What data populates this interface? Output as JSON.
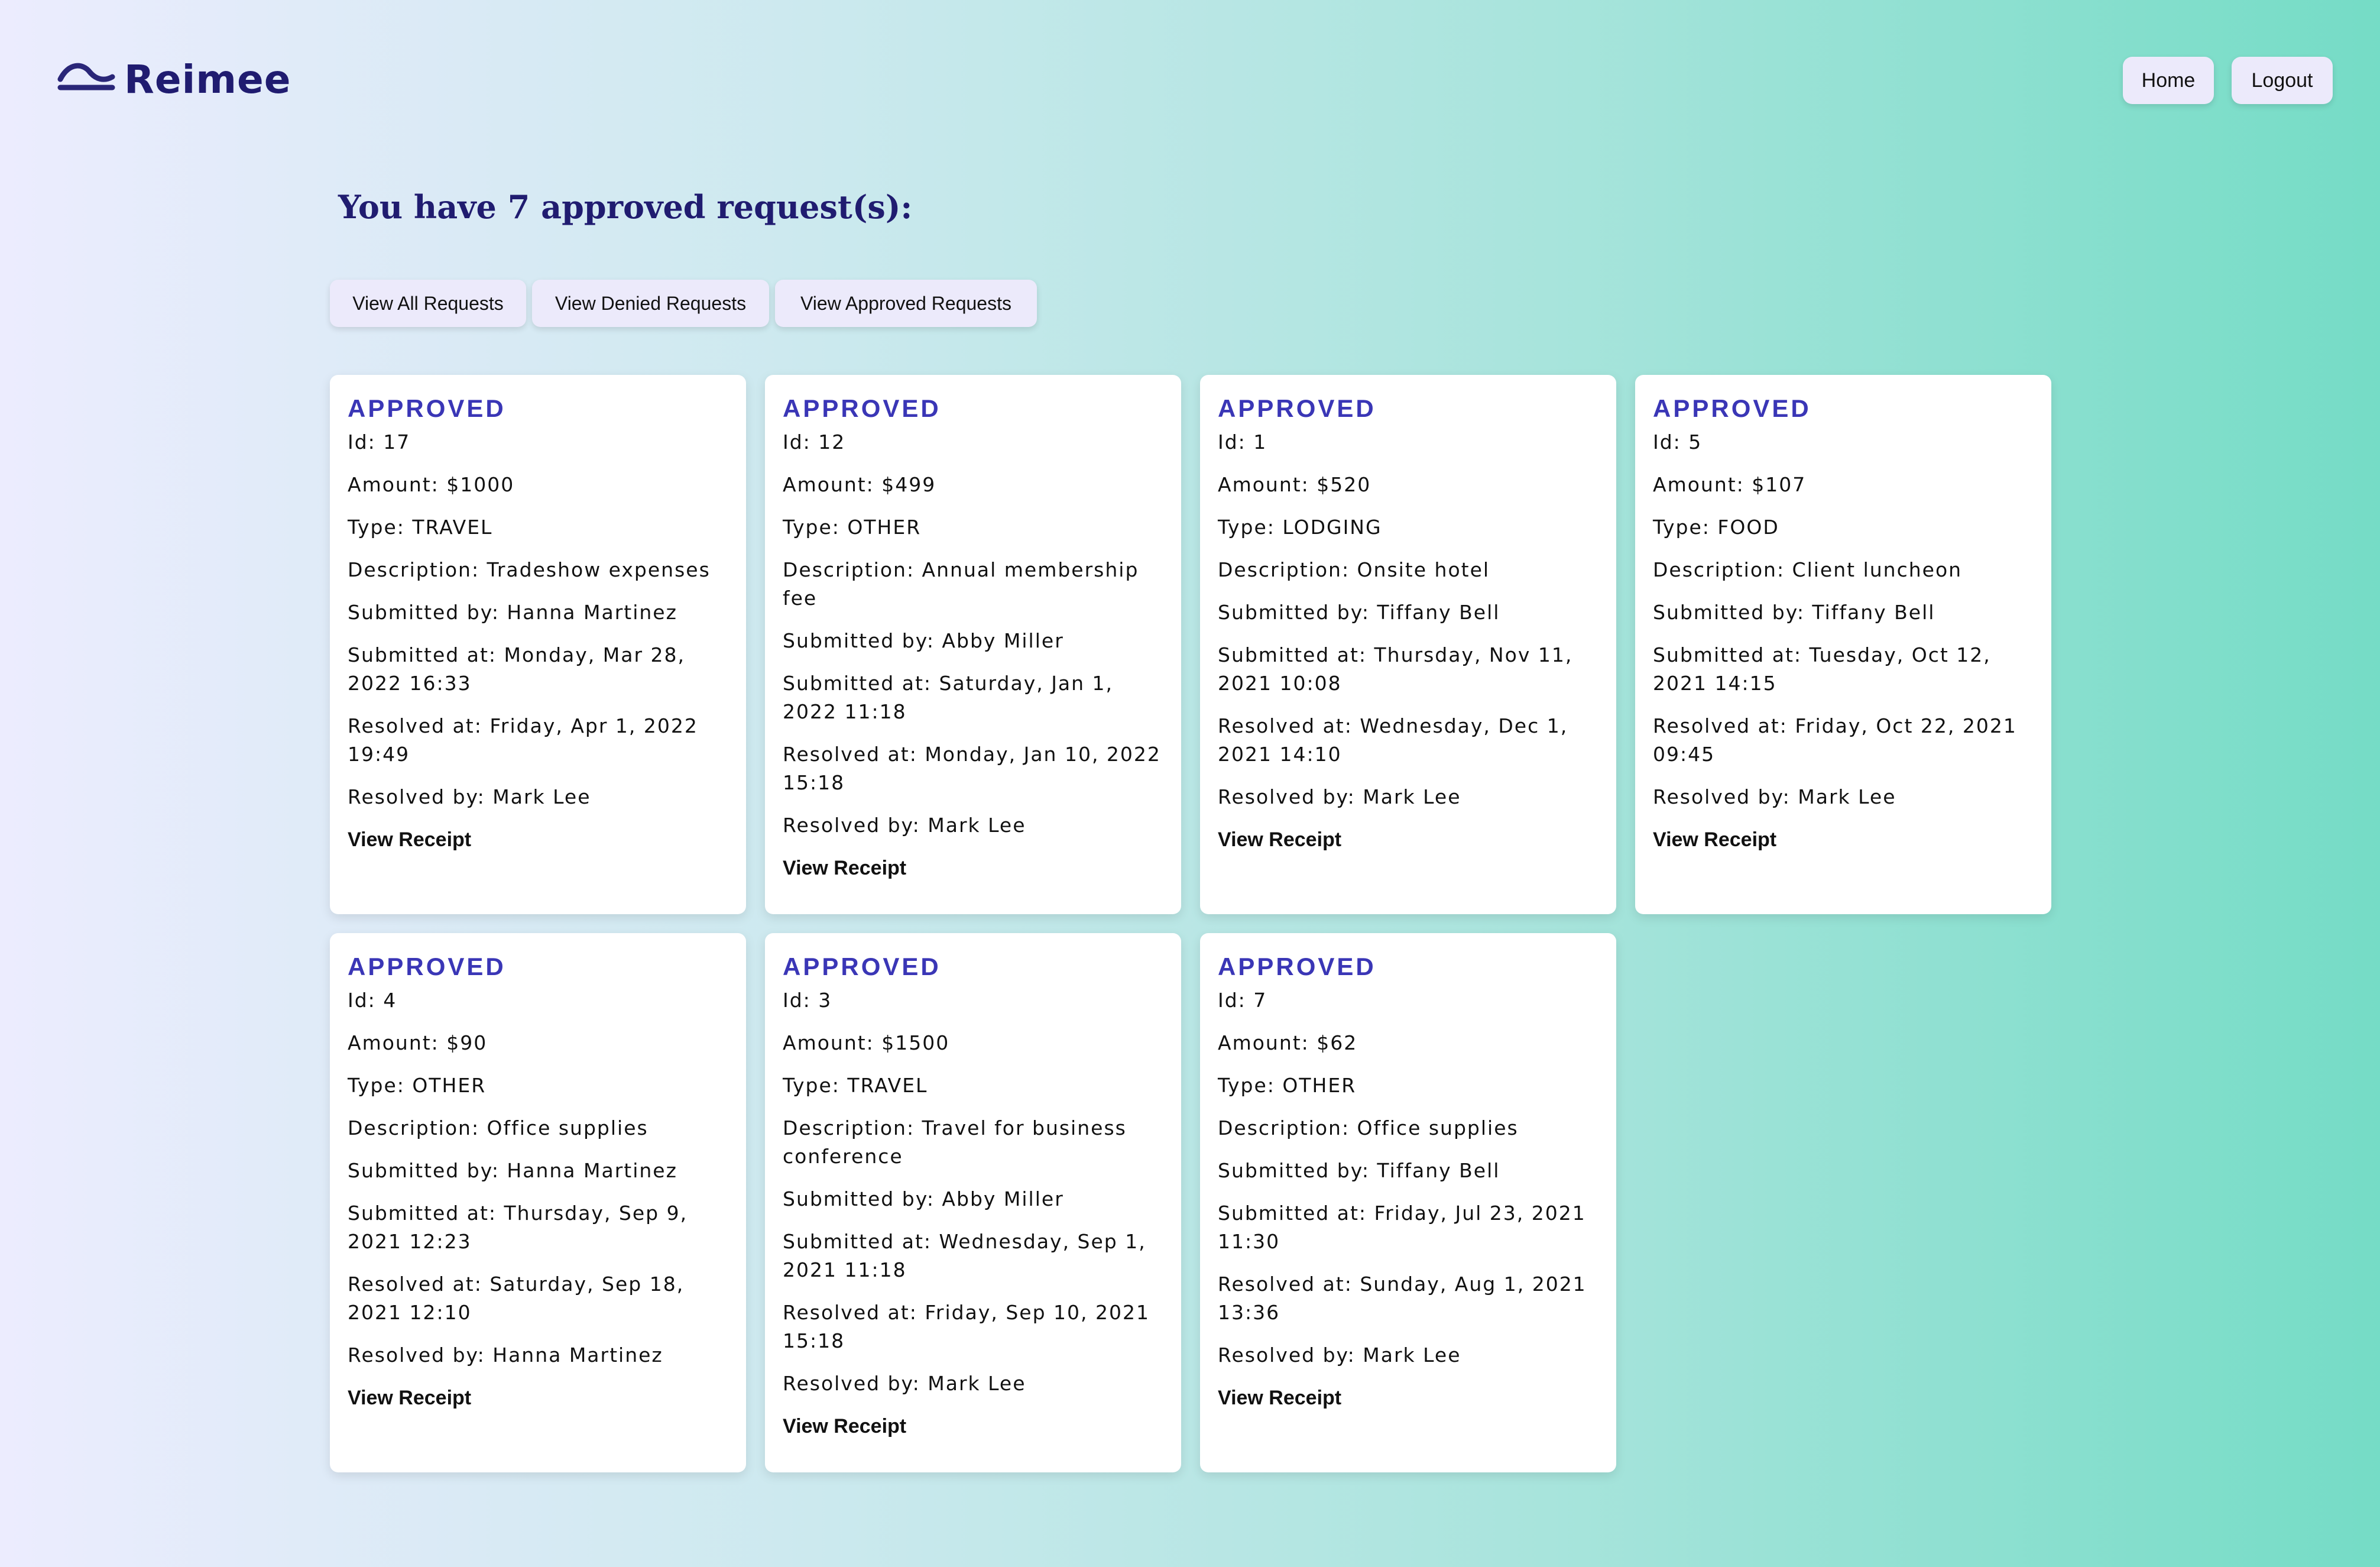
{
  "brand": {
    "name": "Reimee"
  },
  "nav": {
    "home_label": "Home",
    "logout_label": "Logout"
  },
  "page": {
    "title": "You have 7 approved request(s):"
  },
  "filters": {
    "all_label": "View All Requests",
    "denied_label": "View Denied Requests",
    "approved_label": "View Approved Requests"
  },
  "receipt_link_label": "View Receipt",
  "requests": [
    {
      "status": "APPROVED",
      "id": "Id: 17",
      "amount": "Amount: $1000",
      "type": "Type: TRAVEL",
      "description": "Description: Tradeshow expenses",
      "submitted_by": "Submitted by: Hanna Martinez",
      "submitted_at": "Submitted at: Monday, Mar 28, 2022 16:33",
      "resolved_at": "Resolved at: Friday, Apr 1, 2022 19:49",
      "resolved_by": "Resolved by: Mark Lee"
    },
    {
      "status": "APPROVED",
      "id": "Id: 12",
      "amount": "Amount: $499",
      "type": "Type: OTHER",
      "description": "Description: Annual membership fee",
      "submitted_by": "Submitted by: Abby Miller",
      "submitted_at": "Submitted at: Saturday, Jan 1, 2022 11:18",
      "resolved_at": "Resolved at: Monday, Jan 10, 2022 15:18",
      "resolved_by": "Resolved by: Mark Lee"
    },
    {
      "status": "APPROVED",
      "id": "Id: 1",
      "amount": "Amount: $520",
      "type": "Type: LODGING",
      "description": "Description: Onsite hotel",
      "submitted_by": "Submitted by: Tiffany Bell",
      "submitted_at": "Submitted at: Thursday, Nov 11, 2021 10:08",
      "resolved_at": "Resolved at: Wednesday, Dec 1, 2021 14:10",
      "resolved_by": "Resolved by: Mark Lee"
    },
    {
      "status": "APPROVED",
      "id": "Id: 5",
      "amount": "Amount: $107",
      "type": "Type: FOOD",
      "description": "Description: Client luncheon",
      "submitted_by": "Submitted by: Tiffany Bell",
      "submitted_at": "Submitted at: Tuesday, Oct 12, 2021 14:15",
      "resolved_at": "Resolved at: Friday, Oct 22, 2021 09:45",
      "resolved_by": "Resolved by: Mark Lee"
    },
    {
      "status": "APPROVED",
      "id": "Id: 4",
      "amount": "Amount: $90",
      "type": "Type: OTHER",
      "description": "Description: Office supplies",
      "submitted_by": "Submitted by: Hanna Martinez",
      "submitted_at": "Submitted at: Thursday, Sep 9, 2021 12:23",
      "resolved_at": "Resolved at: Saturday, Sep 18, 2021 12:10",
      "resolved_by": "Resolved by: Hanna Martinez"
    },
    {
      "status": "APPROVED",
      "id": "Id: 3",
      "amount": "Amount: $1500",
      "type": "Type: TRAVEL",
      "description": "Description: Travel for business conference",
      "submitted_by": "Submitted by: Abby Miller",
      "submitted_at": "Submitted at: Wednesday, Sep 1, 2021 11:18",
      "resolved_at": "Resolved at: Friday, Sep 10, 2021 15:18",
      "resolved_by": "Resolved by: Mark Lee"
    },
    {
      "status": "APPROVED",
      "id": "Id: 7",
      "amount": "Amount: $62",
      "type": "Type: OTHER",
      "description": "Description: Office supplies",
      "submitted_by": "Submitted by: Tiffany Bell",
      "submitted_at": "Submitted at: Friday, Jul 23, 2021 11:30",
      "resolved_at": "Resolved at: Sunday, Aug 1, 2021 13:36",
      "resolved_by": "Resolved by: Mark Lee"
    }
  ],
  "icons": {
    "logo": "wave-logo-icon"
  },
  "colors": {
    "brand": "#201c70",
    "status": "#3a36b6",
    "button_bg": "#eceafb"
  }
}
